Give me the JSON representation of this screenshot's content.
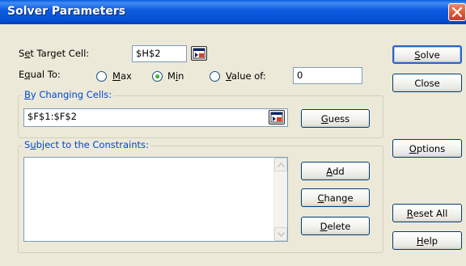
{
  "window": {
    "title": "Solver Parameters",
    "accent_color": "#0a5ce0",
    "close_icon": "close-icon"
  },
  "target": {
    "label_prefix": "S",
    "label_underlined": "e",
    "label_suffix": "t Target Cell:",
    "value": "$H$2"
  },
  "equal_to": {
    "label_prefix": "E",
    "label_underlined": "q",
    "label_suffix": "ual To:",
    "options": [
      {
        "label_prefix": "",
        "label_underlined": "M",
        "label_suffix": "ax",
        "selected": false
      },
      {
        "label_prefix": "M",
        "label_underlined": "i",
        "label_suffix": "n",
        "selected": true
      },
      {
        "label_prefix": "",
        "label_underlined": "V",
        "label_suffix": "alue of:",
        "selected": false
      }
    ],
    "value_of": "0"
  },
  "changing_cells": {
    "label_prefix": "",
    "label_underlined": "B",
    "label_suffix": "y Changing Cells:",
    "value": "$F$1:$F$2"
  },
  "constraints": {
    "label_prefix": "S",
    "label_underlined": "u",
    "label_suffix": "bject to the Constraints:",
    "items": []
  },
  "buttons": {
    "solve": {
      "label_prefix": "",
      "label_underlined": "S",
      "label_suffix": "olve"
    },
    "close": {
      "label_prefix": "",
      "label_underlined": "",
      "label_suffix": "Close"
    },
    "guess": {
      "label_prefix": "",
      "label_underlined": "G",
      "label_suffix": "uess"
    },
    "options": {
      "label_prefix": "",
      "label_underlined": "O",
      "label_suffix": "ptions"
    },
    "add": {
      "label_prefix": "",
      "label_underlined": "A",
      "label_suffix": "dd"
    },
    "change": {
      "label_prefix": "",
      "label_underlined": "C",
      "label_suffix": "hange"
    },
    "delete": {
      "label_prefix": "",
      "label_underlined": "D",
      "label_suffix": "elete"
    },
    "reset_all": {
      "label_prefix": "",
      "label_underlined": "R",
      "label_suffix": "eset All"
    },
    "help": {
      "label_prefix": "",
      "label_underlined": "H",
      "label_suffix": "elp"
    }
  },
  "icons": {
    "collapse_dialog": "collapse-dialog-icon",
    "scroll_up": "scroll-up-arrow-icon",
    "scroll_down": "scroll-down-arrow-icon"
  }
}
